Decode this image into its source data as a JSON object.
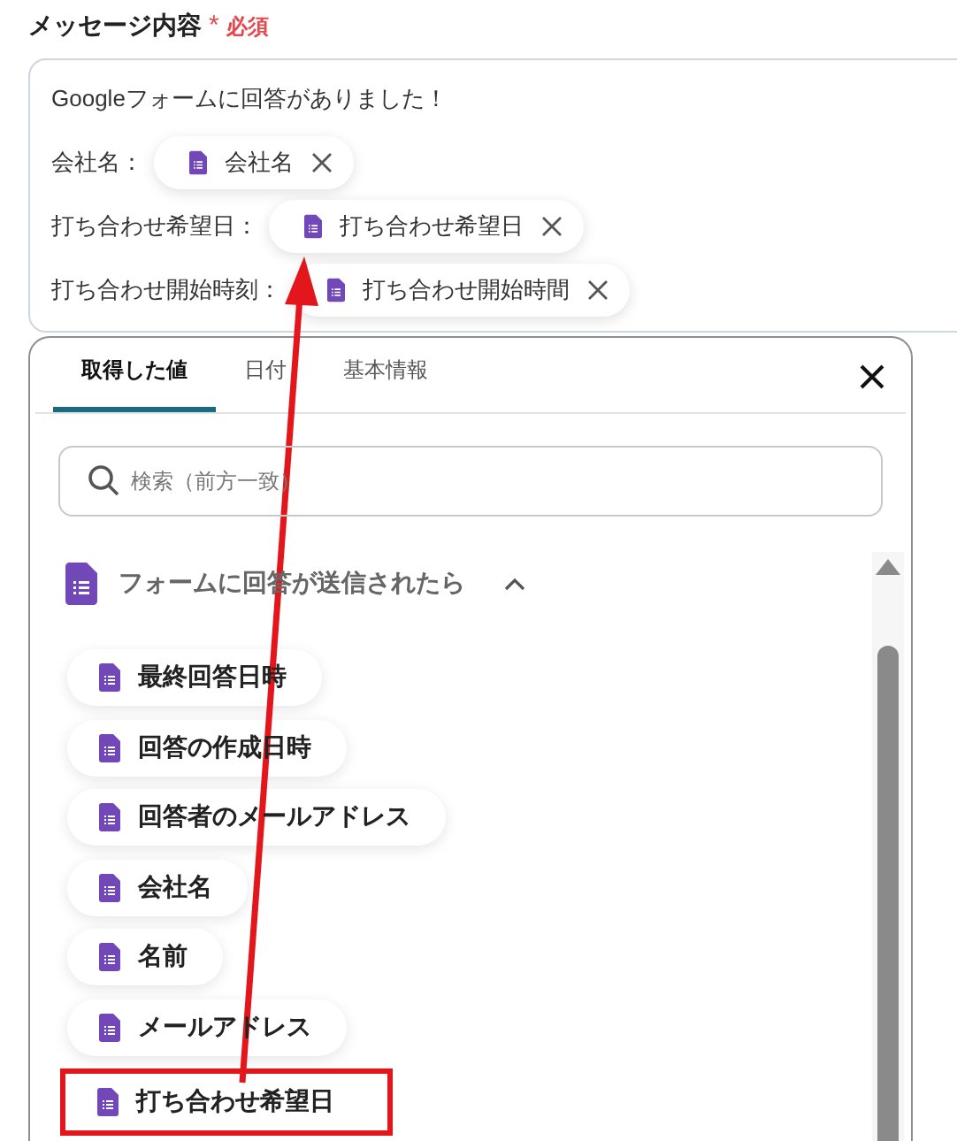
{
  "field": {
    "label": "メッセージ内容",
    "required_mark": "*",
    "required_text": "必須"
  },
  "message": {
    "first_line": "Googleフォームに回答がありました！",
    "rows": [
      {
        "label": "会社名：",
        "chip": "会社名"
      },
      {
        "label": "打ち合わせ希望日：",
        "chip": "打ち合わせ希望日"
      },
      {
        "label": "打ち合わせ開始時刻：",
        "chip": "打ち合わせ開始時間"
      }
    ]
  },
  "panel": {
    "tabs": [
      {
        "label": "取得した値",
        "selected": true
      },
      {
        "label": "日付",
        "selected": false
      },
      {
        "label": "基本情報",
        "selected": false
      }
    ],
    "search": {
      "placeholder": "検索（前方一致）"
    },
    "group": {
      "title": "フォームに回答が送信されたら",
      "expanded": true
    },
    "items": [
      {
        "label": "最終回答日時",
        "highlighted": false
      },
      {
        "label": "回答の作成日時",
        "highlighted": false
      },
      {
        "label": "回答者のメールアドレス",
        "highlighted": false
      },
      {
        "label": "会社名",
        "highlighted": false
      },
      {
        "label": "名前",
        "highlighted": false
      },
      {
        "label": "メールアドレス",
        "highlighted": false
      },
      {
        "label": "打ち合わせ希望日",
        "highlighted": true
      }
    ]
  }
}
